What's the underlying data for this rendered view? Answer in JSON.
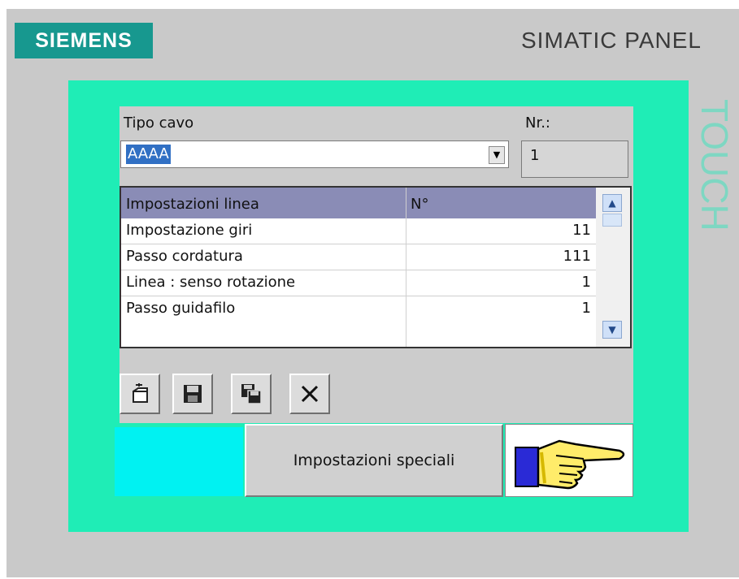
{
  "header": {
    "logo_text": "SIEMENS",
    "panel_label": "SIMATIC PANEL",
    "touch_label": "TOUCH"
  },
  "form": {
    "tipo_cavo_label": "Tipo cavo",
    "tipo_cavo_value": "AAAA",
    "nr_label": "Nr.:",
    "nr_value": "1"
  },
  "table": {
    "columns": [
      "Impostazioni linea",
      "N°"
    ],
    "rows": [
      {
        "name": "Impostazione giri",
        "value": "11"
      },
      {
        "name": "Passo cordatura",
        "value": "111"
      },
      {
        "name": "Linea : senso rotazione",
        "value": "1"
      },
      {
        "name": "Passo guidafilo",
        "value": "1"
      }
    ]
  },
  "toolbar": {
    "icons": [
      "new-record-icon",
      "save-icon",
      "save-as-icon",
      "delete-icon"
    ]
  },
  "actions": {
    "special_label": "Impostazioni speciali",
    "next_icon": "pointing-hand-icon"
  },
  "colors": {
    "screen_bg": "#1fedb6",
    "cyan_block": "#00f2f2",
    "header_row": "#8a8cb6",
    "logo_bg": "#17988f"
  }
}
